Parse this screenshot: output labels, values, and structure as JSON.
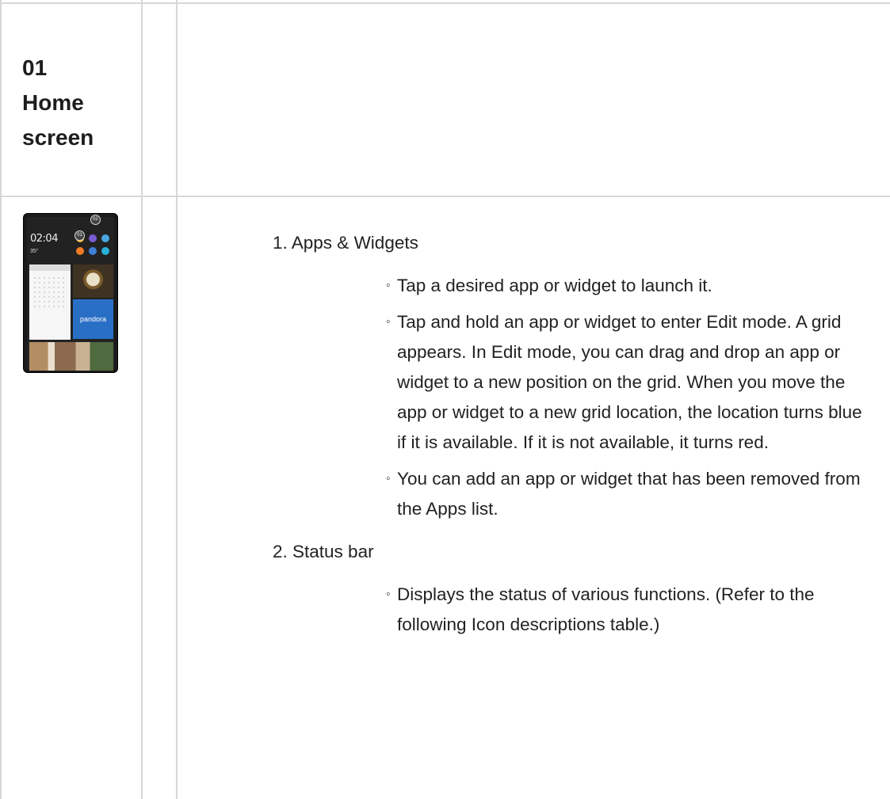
{
  "section": {
    "number": "01",
    "title_line1": "Home",
    "title_line2": "screen"
  },
  "device": {
    "clock": "02:04",
    "temperature": "35°",
    "widget_label": "pandora",
    "callouts": [
      "01",
      "02"
    ]
  },
  "items": [
    {
      "title": "1. Apps & Widgets",
      "bullets": [
        "Tap a desired app or widget to launch it.",
        "Tap and hold an app or widget to enter Edit mode. A grid appears. In Edit mode, you can drag and drop an app or widget to a new position on the grid. When you move the app or widget to a new grid location, the location turns blue if it is available. If it is not available, it turns red.",
        "You can add an app or widget that has been removed from the Apps list."
      ]
    },
    {
      "title": "2. Status bar",
      "bullets": [
        "Displays the status of various functions. (Refer to the following Icon descriptions table.)"
      ]
    }
  ],
  "bullet_marker": "◦"
}
